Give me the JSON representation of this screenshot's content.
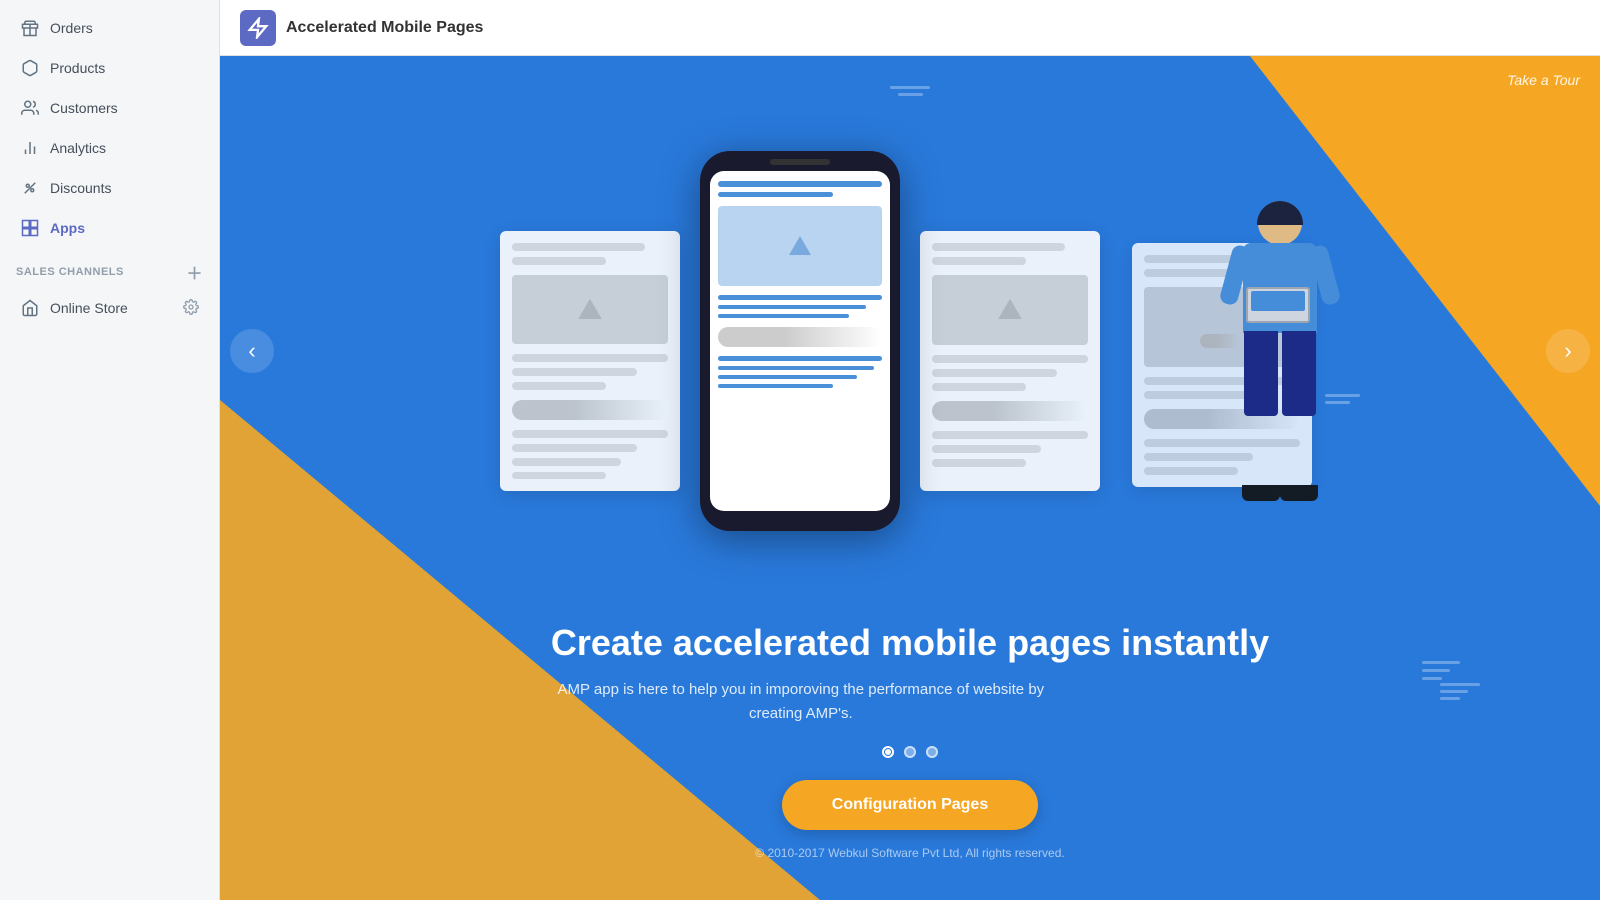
{
  "sidebar": {
    "items": [
      {
        "label": "Orders",
        "icon": "orders-icon",
        "active": false
      },
      {
        "label": "Products",
        "icon": "products-icon",
        "active": false
      },
      {
        "label": "Customers",
        "icon": "customers-icon",
        "active": false
      },
      {
        "label": "Analytics",
        "icon": "analytics-icon",
        "active": false
      },
      {
        "label": "Discounts",
        "icon": "discounts-icon",
        "active": false
      },
      {
        "label": "Apps",
        "icon": "apps-icon",
        "active": true
      }
    ],
    "sales_channels_header": "SALES CHANNELS",
    "online_store_label": "Online Store"
  },
  "header": {
    "app_name": "Accelerated Mobile Pages",
    "take_tour": "Take a Tour"
  },
  "hero": {
    "title": "Create accelerated mobile pages instantly",
    "subtitle": "AMP app is here to help you in imporoving the performance of website by creating AMP's.",
    "config_button": "Configuration Pages",
    "footer": "© 2010-2017 Webkul Software Pvt Ltd, All rights reserved."
  },
  "dots": [
    {
      "active": true
    },
    {
      "active": false
    },
    {
      "active": false
    }
  ],
  "colors": {
    "blue": "#2979db",
    "orange": "#f5a623",
    "sidebar_bg": "#f4f6f8",
    "active_nav": "#5c6ac4"
  }
}
